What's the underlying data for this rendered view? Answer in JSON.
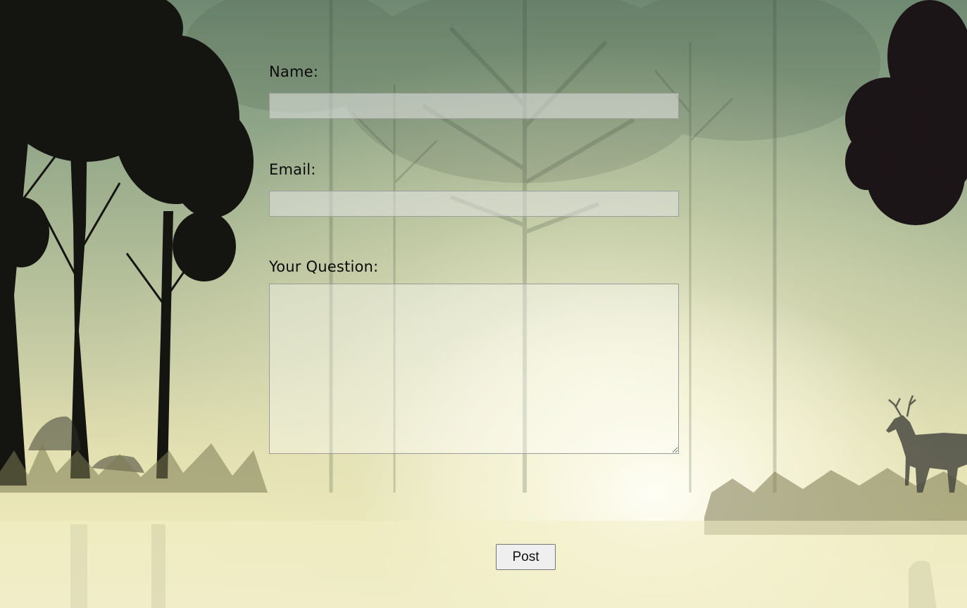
{
  "form": {
    "name_label": "Name:",
    "name_value": "",
    "email_label": "Email:",
    "email_value": "",
    "question_label": "Your Question:",
    "question_value": "",
    "post_label": "Post"
  },
  "background": {
    "scene": "misty-forest-with-deer",
    "colors": {
      "top": "#6f8a72",
      "middle": "#c7cca4",
      "bottom": "#efeccc",
      "silhouette": "#141410"
    }
  },
  "icons": {
    "textarea_resize": "resize-grip-icon"
  }
}
